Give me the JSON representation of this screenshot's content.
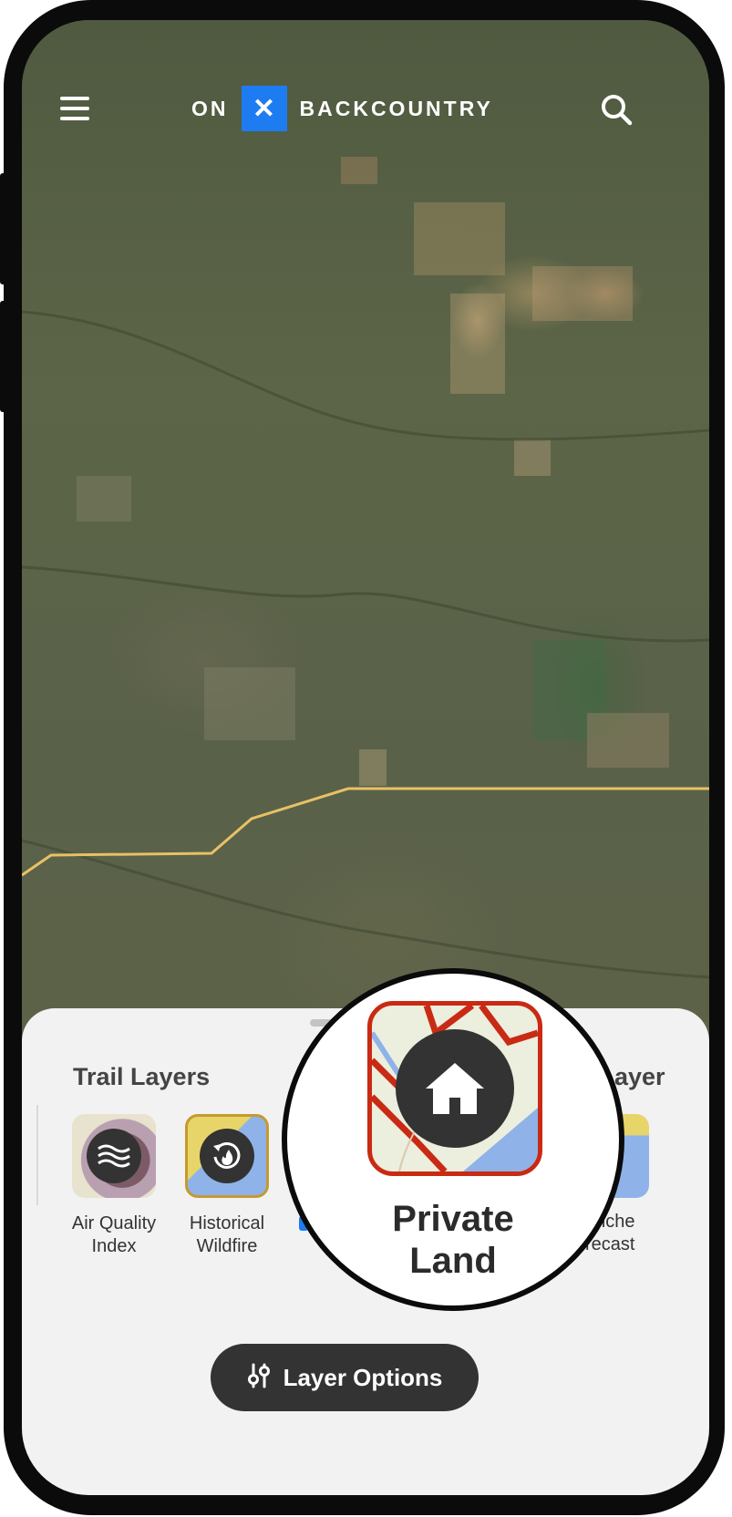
{
  "header": {
    "logo_left": "ON",
    "logo_mark": "✕",
    "logo_right": "BACKCOUNTRY",
    "menu_icon": "hamburger-menu-icon",
    "search_icon": "search-icon"
  },
  "sheet": {
    "section_title": "Trail Layers",
    "next_section_title_partial": "ayer",
    "layers": [
      {
        "label": "Air Quality Index",
        "icon": "waves-icon"
      },
      {
        "label": "Historical Wildfire",
        "icon": "fire-history-icon"
      }
    ],
    "partial_layer_label": "anche\nrecast"
  },
  "magnifier": {
    "label": "Private Land",
    "icon": "home-icon",
    "accent": "#c92a14"
  },
  "layer_options": {
    "label": "Layer Options",
    "icon": "sliders-icon"
  },
  "colors": {
    "brand_blue": "#1e7cf2",
    "trail_line": "#e8c165",
    "pill_bg": "#333333"
  }
}
